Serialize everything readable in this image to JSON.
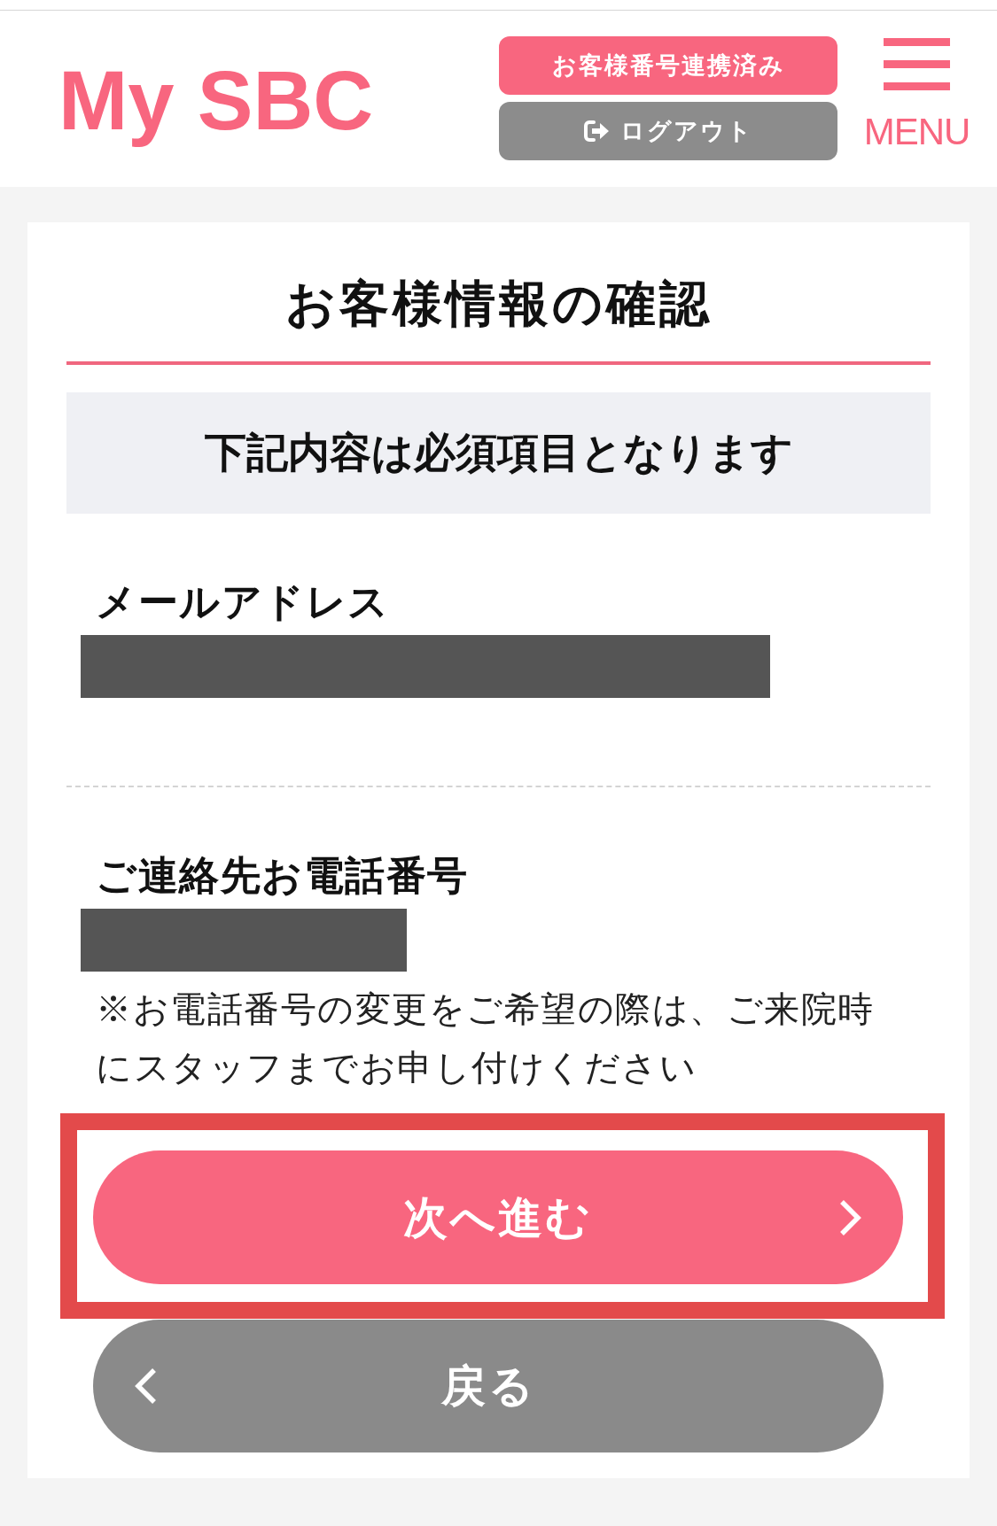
{
  "header": {
    "logo": "My SBC",
    "account_status_button": "お客様番号連携済み",
    "logout_button": "ログアウト",
    "menu_label": "MENU"
  },
  "page": {
    "title": "お客様情報の確認",
    "notice": "下記内容は必須項目となります"
  },
  "fields": [
    {
      "kind": "email",
      "label": "メールアドレス",
      "redacted": true
    },
    {
      "kind": "phone",
      "label": "ご連絡先お電話番号",
      "redacted": true,
      "note": "※お電話番号の変更をご希望の際は、ご来院時にスタッフまでお申し付けください"
    }
  ],
  "buttons": [
    {
      "kind": "next",
      "label": "次へ進む",
      "highlighted": true
    },
    {
      "kind": "back",
      "label": "戻る",
      "highlighted": false
    }
  ]
}
